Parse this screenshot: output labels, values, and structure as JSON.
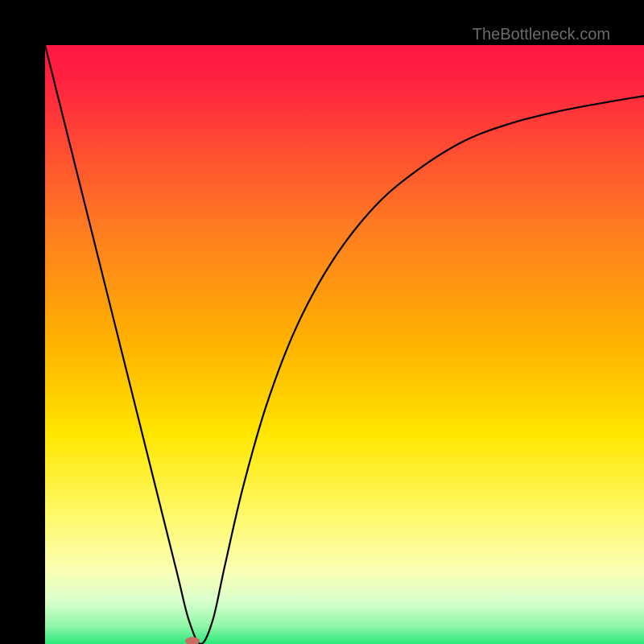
{
  "watermark": "TheBottleneck.com",
  "chart_data": {
    "type": "line",
    "title": "",
    "xlabel": "",
    "ylabel": "",
    "xlim": [
      0,
      100
    ],
    "ylim": [
      0,
      100
    ],
    "grid": false,
    "legend": false,
    "gradient_stops": [
      {
        "pos": 0.0,
        "color": "#ff1744"
      },
      {
        "pos": 0.06,
        "color": "#ff2340"
      },
      {
        "pos": 0.3,
        "color": "#ff7a22"
      },
      {
        "pos": 0.5,
        "color": "#ffb300"
      },
      {
        "pos": 0.65,
        "color": "#ffe600"
      },
      {
        "pos": 0.78,
        "color": "#fff966"
      },
      {
        "pos": 0.88,
        "color": "#fbffb6"
      },
      {
        "pos": 0.93,
        "color": "#d7ffcc"
      },
      {
        "pos": 0.97,
        "color": "#8ff7a8"
      },
      {
        "pos": 1.0,
        "color": "#2ce87a"
      }
    ],
    "series": [
      {
        "name": "bottleneck-curve",
        "x": [
          0,
          3,
          6,
          10,
          14,
          18,
          22,
          24,
          26,
          28,
          30,
          33,
          37,
          42,
          48,
          55,
          62,
          70,
          78,
          86,
          94,
          100
        ],
        "y": [
          100,
          88,
          76,
          60,
          44,
          28,
          12,
          4,
          0,
          4,
          13,
          26,
          40,
          53,
          64,
          73,
          79,
          84,
          87,
          89,
          90.5,
          91.5
        ]
      }
    ],
    "marker": {
      "x": 24.6,
      "y": 0.5,
      "color": "#cb6c63"
    }
  }
}
